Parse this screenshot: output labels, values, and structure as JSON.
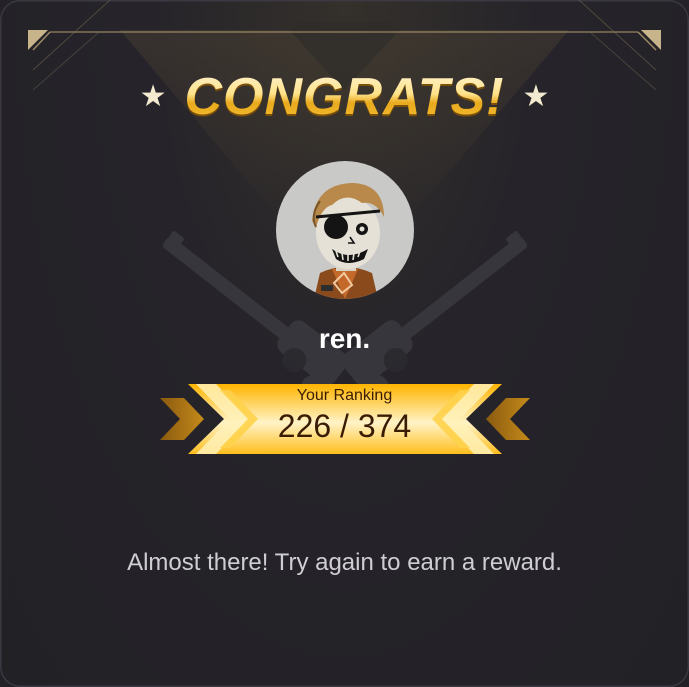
{
  "dialog": {
    "title": "CONGRATS!",
    "star_glyph": "★",
    "username": "ren.",
    "ranking": {
      "label": "Your Ranking",
      "value": "226 / 374",
      "current": 226,
      "total": 374
    },
    "message": "Almost there! Try again to earn a reward."
  },
  "icons": {
    "avatar": "character-avatar",
    "background": "crossed-revolvers-icon",
    "rank_arrows": "chevron-arrows-icon"
  },
  "colors": {
    "background": "#222126",
    "gold_light": "#ffe28a",
    "gold_dark": "#e9a91c",
    "ranking_text": "#3a1c05",
    "message_text": "#cfcfd3",
    "frame_accent": "#b8a57c"
  }
}
